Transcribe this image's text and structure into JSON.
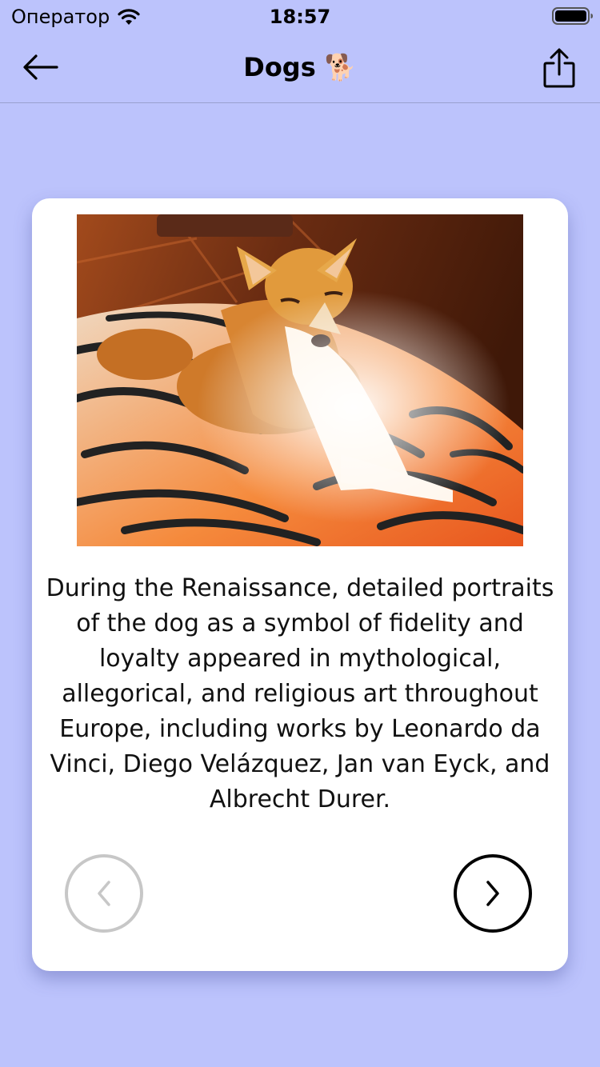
{
  "status_bar": {
    "carrier": "Оператор",
    "time": "18:57"
  },
  "nav": {
    "title": "Dogs 🐕"
  },
  "card": {
    "fact": "During the Renaissance, detailed portraits of the dog as a symbol of fidelity and loyalty appeared in mythological, allegorical, and religious art throughout Europe, including works by Leonardo da Vinci, Diego Velázquez, Jan van Eyck, and Albrecht Durer.",
    "prev_enabled": false,
    "next_enabled": true
  },
  "icons": {
    "back": "arrow-left-icon",
    "share": "share-icon",
    "prev": "chevron-left-icon",
    "next": "chevron-right-icon",
    "wifi": "wifi-icon",
    "battery": "battery-icon"
  },
  "colors": {
    "background": "#bcc3fc",
    "card": "#ffffff",
    "disabled": "#c7c7c7",
    "enabled": "#000000"
  }
}
